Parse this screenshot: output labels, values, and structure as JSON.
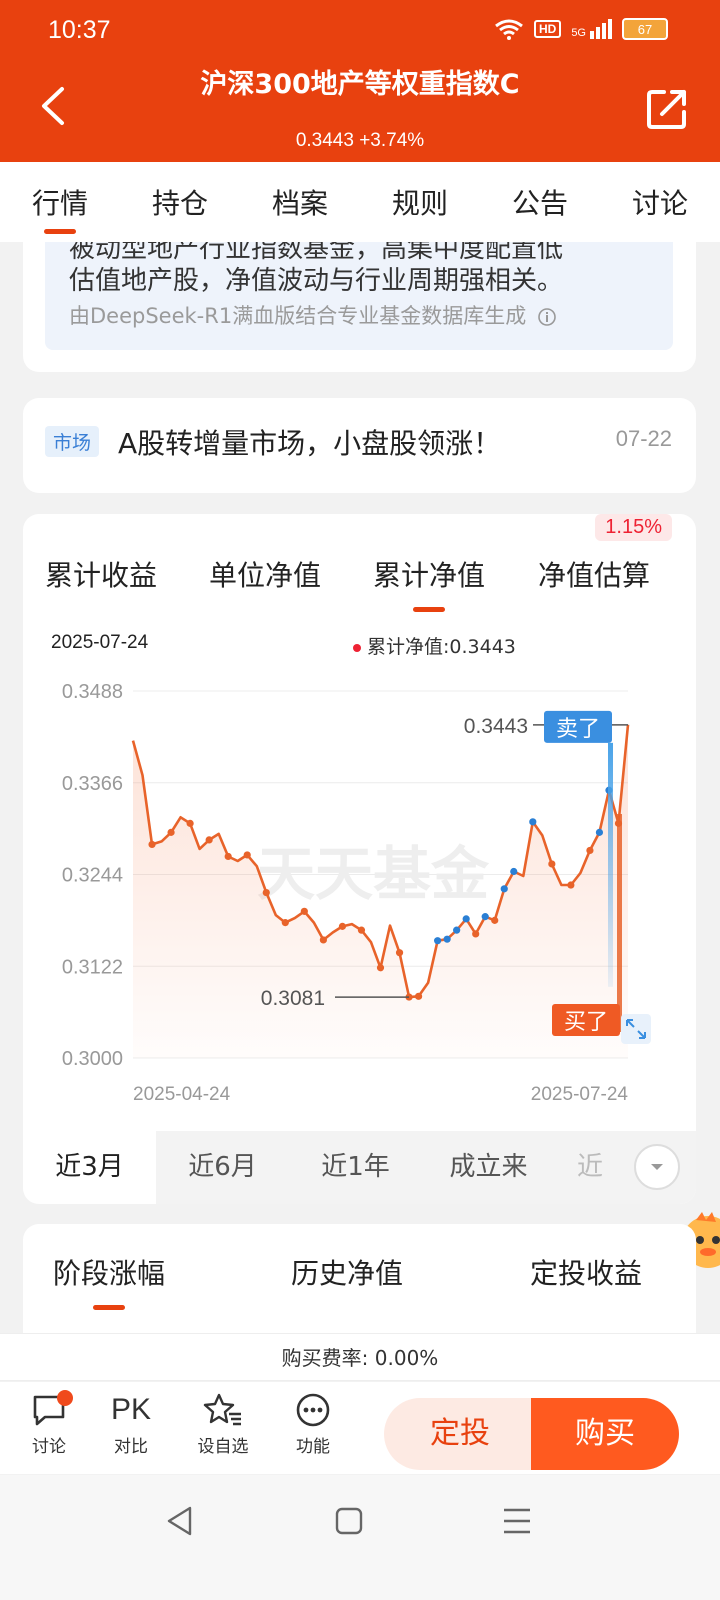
{
  "status": {
    "time": "10:37",
    "hd": "HD",
    "net": "5G",
    "battery": "67"
  },
  "header": {
    "title": "沪深300地产等权重指数C",
    "subtitle": "0.3443 +3.74%"
  },
  "tabs": [
    {
      "label": "行情",
      "active": true
    },
    {
      "label": "持仓"
    },
    {
      "label": "档案"
    },
    {
      "label": "规则"
    },
    {
      "label": "公告"
    },
    {
      "label": "讨论"
    }
  ],
  "ai_summary": {
    "line1": "被动型地产行业指数基金，高集中度配置低",
    "line2": "估值地产股，净值波动与行业周期强相关。",
    "source": "由DeepSeek-R1满血版结合专业基金数据库生成"
  },
  "news": {
    "tag": "市场",
    "text": "A股转增量市场，小盘股领涨！",
    "date": "07-22"
  },
  "chart_tabs": [
    "累计收益",
    "单位净值",
    "累计净值",
    "净值估算"
  ],
  "chart_active_tab": "累计净值",
  "estimate_badge": "1.15%",
  "chart_info": {
    "date": "2025-07-24",
    "legend": "累计净值:0.3443"
  },
  "ranges": [
    "近3月",
    "近6月",
    "近1年",
    "成立来",
    "近"
  ],
  "chart_data": {
    "type": "line",
    "xlabel": "",
    "ylabel": "",
    "x_range": [
      "2025-04-24",
      "2025-07-24"
    ],
    "ylim": [
      0.3,
      0.3488
    ],
    "yticks": [
      "0.3488",
      "0.3366",
      "0.3244",
      "0.3122",
      "0.3000"
    ],
    "xticks": [
      "2025-04-24",
      "2025-07-24"
    ],
    "grid": true,
    "series": [
      {
        "color": "#e8632a",
        "values": [
          0.3422,
          0.3376,
          0.3284,
          0.3288,
          0.33,
          0.332,
          0.3312,
          0.3278,
          0.329,
          0.3298,
          0.3268,
          0.3262,
          0.327,
          0.3255,
          0.322,
          0.319,
          0.318,
          0.3186,
          0.3195,
          0.318,
          0.3157,
          0.3167,
          0.3175,
          0.3178,
          0.317,
          0.3154,
          0.312,
          0.3176,
          0.314,
          0.3081,
          0.3082,
          0.31,
          0.3156,
          0.3158,
          0.317,
          0.3185,
          0.3165,
          0.3188,
          0.3183,
          0.3225,
          0.3248,
          0.3242,
          0.3314,
          0.3296,
          0.3258,
          0.323,
          0.323,
          0.3246,
          0.3276,
          0.33,
          0.3356,
          0.3312,
          0.3443
        ]
      }
    ],
    "annotations": [
      {
        "label": "0.3443",
        "tag": "卖了"
      },
      {
        "label": "0.3081",
        "tag": "买了"
      }
    ],
    "watermark": "天天基金"
  },
  "stage_tabs": [
    "阶段涨幅",
    "历史净值",
    "定投收益"
  ],
  "fee": "购买费率: 0.00%",
  "actions": [
    {
      "label": "讨论",
      "icon": "chat-icon"
    },
    {
      "label": "对比",
      "icon": "pk-icon",
      "glyph": "PK"
    },
    {
      "label": "设自选",
      "icon": "star-list-icon"
    },
    {
      "label": "功能",
      "icon": "more-icon"
    }
  ],
  "buttons": {
    "dingtou": "定投",
    "buy": "购买"
  }
}
